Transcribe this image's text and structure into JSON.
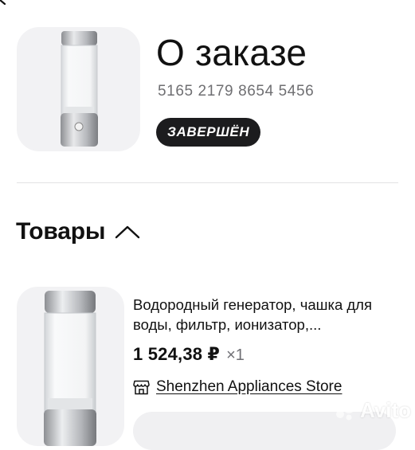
{
  "order": {
    "title": "О заказе",
    "number": "5165 2179 8654 5456",
    "status": "ЗАВЕРШЁН"
  },
  "section": {
    "title": "Товары",
    "toggle_icon": "chevron-up-icon"
  },
  "item": {
    "name": "Водородный генератор, чашка для воды, фильтр, ионизатор,...",
    "price": "1 524,38 ₽",
    "quantity": "×1",
    "store_icon": "store-icon",
    "store_name": "Shenzhen Appliances Store"
  },
  "watermark": {
    "text": "Avito"
  },
  "colors": {
    "badge_bg": "#1c1c1e",
    "thumb_bg": "#f2f2f4",
    "muted": "#6f6f72"
  }
}
